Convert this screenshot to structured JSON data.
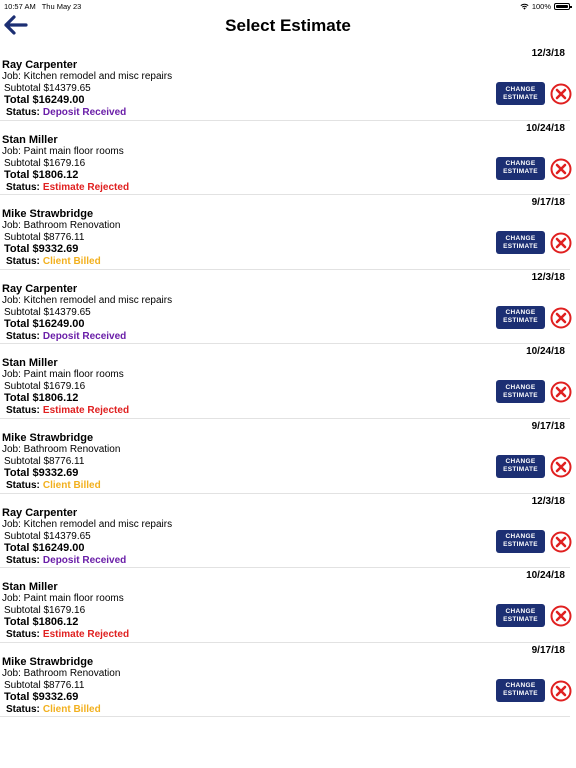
{
  "status_bar": {
    "time": "10:57 AM",
    "date": "Thu May 23",
    "battery": "100%"
  },
  "nav": {
    "title": "Select Estimate"
  },
  "labels": {
    "status": "Status:",
    "change_estimate": "CHANGE\nESTIMATE"
  },
  "colors": {
    "brand": "#1c2f73",
    "delete": "#e02020",
    "deposit_received": "#6a1ea8",
    "estimate_rejected": "#e02020",
    "client_billed": "#f2b01e"
  },
  "estimates": [
    {
      "date": "12/3/18",
      "client": "Ray Carpenter",
      "job": "Job: Kitchen remodel and misc repairs",
      "subtotal": "Subtotal $14379.65",
      "total": "Total $16249.00",
      "status": "Deposit Received",
      "status_color": "#6a1ea8"
    },
    {
      "date": "10/24/18",
      "client": "Stan Miller",
      "job": "Job: Paint main floor rooms",
      "subtotal": "Subtotal $1679.16",
      "total": "Total $1806.12",
      "status": "Estimate Rejected",
      "status_color": "#e02020"
    },
    {
      "date": "9/17/18",
      "client": "Mike Strawbridge",
      "job": "Job: Bathroom Renovation",
      "subtotal": "Subtotal $8776.11",
      "total": "Total $9332.69",
      "status": "Client Billed",
      "status_color": "#f2b01e"
    },
    {
      "date": "12/3/18",
      "client": "Ray Carpenter",
      "job": "Job: Kitchen remodel and misc repairs",
      "subtotal": "Subtotal $14379.65",
      "total": "Total $16249.00",
      "status": "Deposit Received",
      "status_color": "#6a1ea8"
    },
    {
      "date": "10/24/18",
      "client": "Stan Miller",
      "job": "Job: Paint main floor rooms",
      "subtotal": "Subtotal $1679.16",
      "total": "Total $1806.12",
      "status": "Estimate Rejected",
      "status_color": "#e02020"
    },
    {
      "date": "9/17/18",
      "client": "Mike Strawbridge",
      "job": "Job: Bathroom Renovation",
      "subtotal": "Subtotal $8776.11",
      "total": "Total $9332.69",
      "status": "Client Billed",
      "status_color": "#f2b01e"
    },
    {
      "date": "12/3/18",
      "client": "Ray Carpenter",
      "job": "Job: Kitchen remodel and misc repairs",
      "subtotal": "Subtotal $14379.65",
      "total": "Total $16249.00",
      "status": "Deposit Received",
      "status_color": "#6a1ea8"
    },
    {
      "date": "10/24/18",
      "client": "Stan Miller",
      "job": "Job: Paint main floor rooms",
      "subtotal": "Subtotal $1679.16",
      "total": "Total $1806.12",
      "status": "Estimate Rejected",
      "status_color": "#e02020"
    },
    {
      "date": "9/17/18",
      "client": "Mike Strawbridge",
      "job": "Job: Bathroom Renovation",
      "subtotal": "Subtotal $8776.11",
      "total": "Total $9332.69",
      "status": "Client Billed",
      "status_color": "#f2b01e"
    }
  ]
}
